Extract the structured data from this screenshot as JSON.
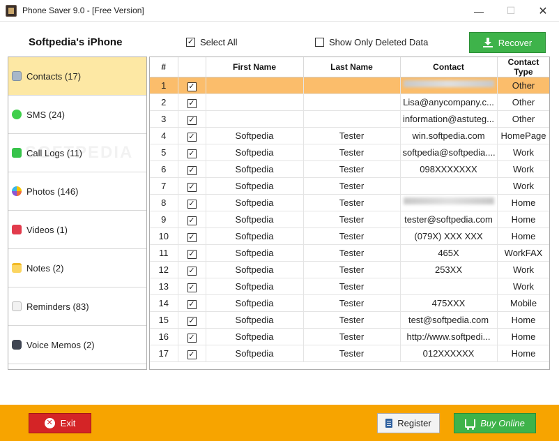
{
  "window": {
    "title": "Phone Saver 9.0 - [Free Version]",
    "min_glyph": "—",
    "max_glyph": "☐",
    "close_glyph": "✕"
  },
  "header": {
    "device_name": "Softpedia's iPhone",
    "select_all_label": "Select All",
    "select_all_checked": true,
    "show_deleted_label": "Show Only Deleted Data",
    "show_deleted_checked": false,
    "recover_label": "Recover"
  },
  "sidebar": {
    "items": [
      {
        "label": "Contacts (17)",
        "icon": "contacts-icon",
        "active": true
      },
      {
        "label": "SMS (24)",
        "icon": "sms-icon",
        "active": false
      },
      {
        "label": "Call Logs (11)",
        "icon": "call-logs-icon",
        "active": false
      },
      {
        "label": "Photos (146)",
        "icon": "photos-icon",
        "active": false
      },
      {
        "label": "Videos (1)",
        "icon": "videos-icon",
        "active": false
      },
      {
        "label": "Notes (2)",
        "icon": "notes-icon",
        "active": false
      },
      {
        "label": "Reminders (83)",
        "icon": "reminders-icon",
        "active": false
      },
      {
        "label": "Voice Memos (2)",
        "icon": "voice-memos-icon",
        "active": false
      }
    ]
  },
  "watermark": "SOFTPEDIA",
  "table": {
    "columns": [
      "#",
      "",
      "First Name",
      "Last Name",
      "Contact",
      "Contact Type"
    ],
    "selected_row": 0,
    "rows": [
      {
        "num": "1",
        "checked": true,
        "first": "",
        "last": "",
        "contact": "",
        "type": "Other",
        "blurred": true
      },
      {
        "num": "2",
        "checked": true,
        "first": "",
        "last": "",
        "contact": "Lisa@anycompany.c...",
        "type": "Other",
        "blurred": false
      },
      {
        "num": "3",
        "checked": true,
        "first": "",
        "last": "",
        "contact": "information@astuteg...",
        "type": "Other",
        "blurred": false
      },
      {
        "num": "4",
        "checked": true,
        "first": "Softpedia",
        "last": "Tester",
        "contact": "win.softpedia.com",
        "type": "HomePage",
        "blurred": false
      },
      {
        "num": "5",
        "checked": true,
        "first": "Softpedia",
        "last": "Tester",
        "contact": "softpedia@softpedia....",
        "type": "Work",
        "blurred": false
      },
      {
        "num": "6",
        "checked": true,
        "first": "Softpedia",
        "last": "Tester",
        "contact": "098XXXXXXX",
        "type": "Work",
        "blurred": false
      },
      {
        "num": "7",
        "checked": true,
        "first": "Softpedia",
        "last": "Tester",
        "contact": "",
        "type": "Work",
        "blurred": false
      },
      {
        "num": "8",
        "checked": true,
        "first": "Softpedia",
        "last": "Tester",
        "contact": "",
        "type": "Home",
        "blurred": true
      },
      {
        "num": "9",
        "checked": true,
        "first": "Softpedia",
        "last": "Tester",
        "contact": "tester@softpedia.com",
        "type": "Home",
        "blurred": false
      },
      {
        "num": "10",
        "checked": true,
        "first": "Softpedia",
        "last": "Tester",
        "contact": "(079X) XXX XXX",
        "type": "Home",
        "blurred": false
      },
      {
        "num": "11",
        "checked": true,
        "first": "Softpedia",
        "last": "Tester",
        "contact": "465X",
        "type": "WorkFAX",
        "blurred": false
      },
      {
        "num": "12",
        "checked": true,
        "first": "Softpedia",
        "last": "Tester",
        "contact": "253XX",
        "type": "Work",
        "blurred": false
      },
      {
        "num": "13",
        "checked": true,
        "first": "Softpedia",
        "last": "Tester",
        "contact": "",
        "type": "Work",
        "blurred": false
      },
      {
        "num": "14",
        "checked": true,
        "first": "Softpedia",
        "last": "Tester",
        "contact": "475XXX",
        "type": "Mobile",
        "blurred": false
      },
      {
        "num": "15",
        "checked": true,
        "first": "Softpedia",
        "last": "Tester",
        "contact": "test@softpedia.com",
        "type": "Home",
        "blurred": false
      },
      {
        "num": "16",
        "checked": true,
        "first": "Softpedia",
        "last": "Tester",
        "contact": "http://www.softpedi...",
        "type": "Home",
        "blurred": false
      },
      {
        "num": "17",
        "checked": true,
        "first": "Softpedia",
        "last": "Tester",
        "contact": "012XXXXXX",
        "type": "Home",
        "blurred": false
      }
    ]
  },
  "footer": {
    "exit_label": "Exit",
    "register_label": "Register",
    "buy_label": "Buy Online"
  },
  "colors": {
    "accent_orange": "#f7a400",
    "selected_row": "#fbbd6b",
    "active_sidebar": "#fde8a4",
    "green_button": "#3eb34a",
    "red_button": "#d42426"
  }
}
